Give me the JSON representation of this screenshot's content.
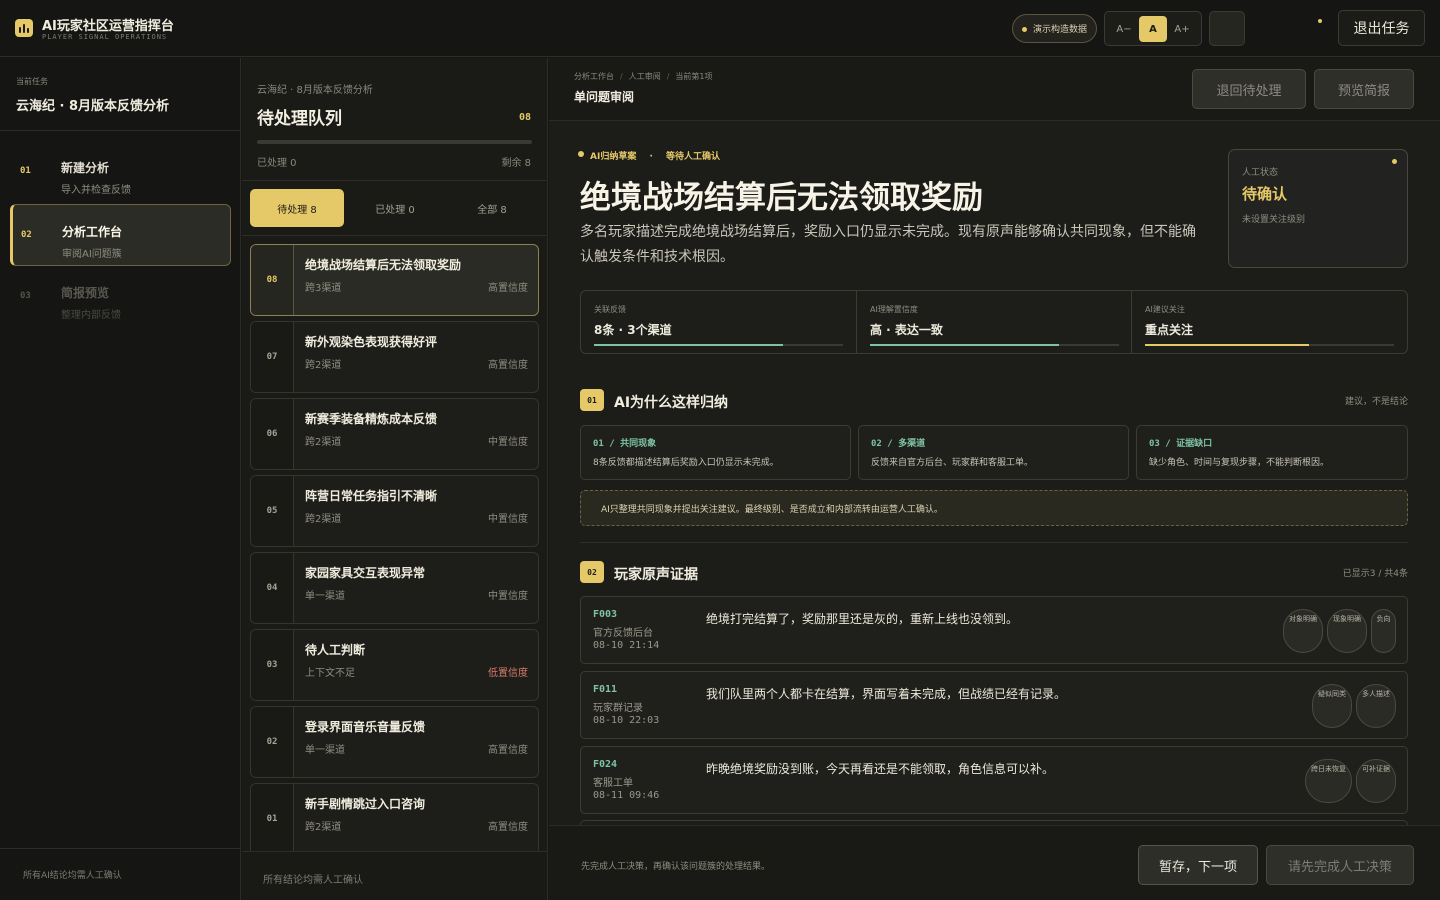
{
  "app": {
    "title": "AI玩家社区运营指挥台",
    "subtitle": "PLAYER SIGNAL OPERATIONS",
    "demo_badge": "演示构造数据",
    "font_controls": [
      "A−",
      "A",
      "A+"
    ],
    "exit_label": "退出任务",
    "accent_color": "#e5c868"
  },
  "sidebar": {
    "current_label": "当前任务",
    "current_task": "云海纪 · 8月版本反馈分析",
    "steps": [
      {
        "num": "01",
        "title": "新建分析",
        "desc": "导入并检查反馈"
      },
      {
        "num": "02",
        "title": "分析工作台",
        "desc": "审阅AI问题簇"
      },
      {
        "num": "03",
        "title": "简报预览",
        "desc": "整理内部反馈"
      }
    ],
    "footer": "所有AI结论均需人工确认"
  },
  "queue": {
    "crumb": "云海纪 · 8月版本反馈分析",
    "title": "待处理队列",
    "count": "08",
    "progress": 0,
    "done_text": "已处理 0",
    "remaining_text": "剩余 8",
    "tabs": [
      "待处理 8",
      "已处理 0",
      "全部 8"
    ],
    "items": [
      {
        "num": "08",
        "title": "绝境战场结算后无法领取奖励",
        "channels": "跨3渠道",
        "confidence": "高置信度"
      },
      {
        "num": "07",
        "title": "新外观染色表现获得好评",
        "channels": "跨2渠道",
        "confidence": "高置信度"
      },
      {
        "num": "06",
        "title": "新赛季装备精炼成本反馈",
        "channels": "跨2渠道",
        "confidence": "中置信度"
      },
      {
        "num": "05",
        "title": "阵营日常任务指引不清晰",
        "channels": "跨2渠道",
        "confidence": "中置信度"
      },
      {
        "num": "04",
        "title": "家园家具交互表现异常",
        "channels": "单一渠道",
        "confidence": "中置信度"
      },
      {
        "num": "03",
        "title": "待人工判断",
        "channels": "上下文不足",
        "confidence": "低置信度"
      },
      {
        "num": "02",
        "title": "登录界面音乐音量反馈",
        "channels": "单一渠道",
        "confidence": "高置信度"
      },
      {
        "num": "01",
        "title": "新手剧情跳过入口咨询",
        "channels": "跨2渠道",
        "confidence": "高置信度"
      }
    ],
    "footer": "所有结论均需人工确认"
  },
  "main": {
    "breadcrumb": [
      "分析工作台",
      "人工审阅",
      "当前第1项"
    ],
    "title": "单问题审阅",
    "btn_back": "退回待处理",
    "btn_preview": "预览简报",
    "status_a": "AI归纳草案",
    "status_sep": "·",
    "status_b": "等待人工确认",
    "issue_title": "绝境战场结算后无法领取奖励",
    "issue_desc": "多名玩家描述完成绝境战场结算后，奖励入口仍显示未完成。现有原声能够确认共同现象，但不能确认触发条件和技术根因。",
    "state_label": "人工状态",
    "state_value": "待确认",
    "state_sub": "未设置关注级别",
    "metrics": [
      {
        "label": "关联反馈",
        "value": "8条 · 3个渠道",
        "fill": 0.76,
        "color": "#7fc2a4"
      },
      {
        "label": "AI理解置信度",
        "value": "高 · 表达一致",
        "fill": 0.76,
        "color": "#7fc2a4"
      },
      {
        "label": "AI建议关注",
        "value": "重点关注",
        "fill": 0.66,
        "color": "#e5c868"
      }
    ],
    "section1": {
      "badge": "01",
      "title": "AI为什么这样归纳",
      "note": "建议，不是结论"
    },
    "reasons": [
      {
        "title": "01 / 共同现象",
        "desc": "8条反馈都描述结算后奖励入口仍显示未完成。"
      },
      {
        "title": "02 / 多渠道",
        "desc": "反馈来自官方后台、玩家群和客服工单。"
      },
      {
        "title": "03 / 证据缺口",
        "desc": "缺少角色、时间与复现步骤，不能判断根因。"
      }
    ],
    "ai_note": "AI只整理共同现象并提出关注建议。最终级别、是否成立和内部流转由运营人工确认。",
    "section2": {
      "badge": "02",
      "title": "玩家原声证据",
      "note": "已显示3 / 共4条"
    },
    "evidence": [
      {
        "id": "F003",
        "source": "官方反馈后台",
        "time": "08-10 21:14",
        "text": "绝境打完结算了，奖励那里还是灰的，重新上线也没领到。",
        "tags": [
          "对象明确",
          "现象明确",
          "负向"
        ]
      },
      {
        "id": "F011",
        "source": "玩家群记录",
        "time": "08-10 22:03",
        "text": "我们队里两个人都卡在结算，界面写着未完成，但战绩已经有记录。",
        "tags": [
          "疑似同类",
          "多人描述"
        ]
      },
      {
        "id": "F024",
        "source": "客服工单",
        "time": "08-11 09:46",
        "text": "昨晚绝境奖励没到账，今天再看还是不能领取，角色信息可以补。",
        "tags": [
          "跨日未恢复",
          "可补证据"
        ]
      }
    ],
    "footer_note": "先完成人工决策，再确认该问题簇的处理结果。",
    "btn_next": "暂存，下一项",
    "btn_done": "请先完成人工决策"
  }
}
